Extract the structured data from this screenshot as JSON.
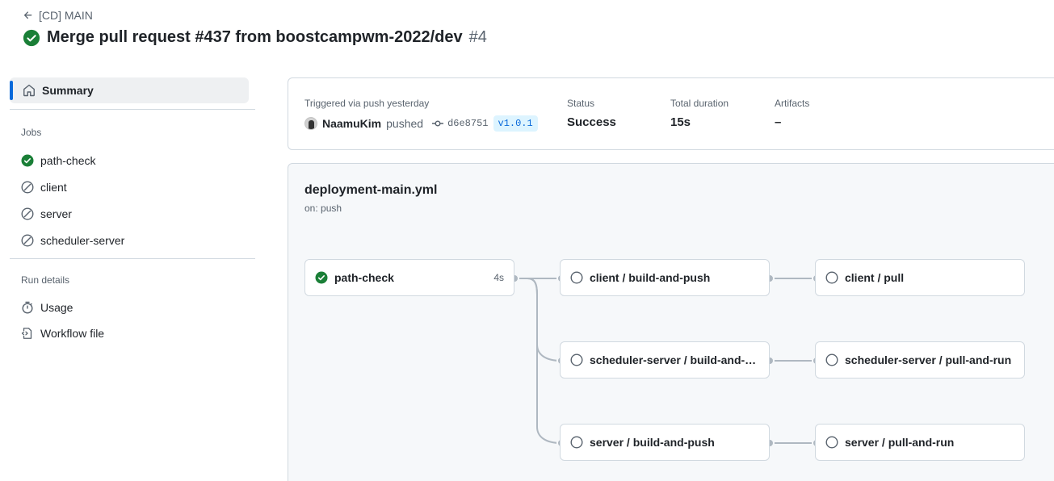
{
  "header": {
    "back_label": "[CD] MAIN",
    "title": "Merge pull request #437 from boostcampwm-2022/dev",
    "run_number": "#4",
    "status_icon": "success-check-icon",
    "colors": {
      "success": "#1a7f37",
      "accent": "#0969da"
    }
  },
  "sidebar": {
    "summary_label": "Summary",
    "jobs_heading": "Jobs",
    "jobs": [
      {
        "label": "path-check",
        "status": "success"
      },
      {
        "label": "client",
        "status": "skipped"
      },
      {
        "label": "server",
        "status": "skipped"
      },
      {
        "label": "scheduler-server",
        "status": "skipped"
      }
    ],
    "run_details_heading": "Run details",
    "usage_label": "Usage",
    "workflow_file_label": "Workflow file"
  },
  "summary": {
    "triggered_label": "Triggered via push yesterday",
    "actor": "NaamuKim",
    "action": "pushed",
    "commit_sha": "d6e8751",
    "tag": "v1.0.1",
    "status_label": "Status",
    "status_value": "Success",
    "duration_label": "Total duration",
    "duration_value": "15s",
    "artifacts_label": "Artifacts",
    "artifacts_value": "–"
  },
  "workflow": {
    "file_name": "deployment-main.yml",
    "trigger": "on: push",
    "jobs": {
      "path_check": {
        "label": "path-check",
        "duration": "4s",
        "status": "success"
      },
      "client_build": {
        "label": "client / build-and-push",
        "status": "pending"
      },
      "client_pull": {
        "label": "client / pull",
        "status": "pending"
      },
      "scheduler_build": {
        "label": "scheduler-server / build-and-push",
        "status": "pending"
      },
      "scheduler_pull": {
        "label": "scheduler-server / pull-and-run",
        "status": "pending"
      },
      "server_build": {
        "label": "server / build-and-push",
        "status": "pending"
      },
      "server_pull": {
        "label": "server / pull-and-run",
        "status": "pending"
      }
    }
  }
}
